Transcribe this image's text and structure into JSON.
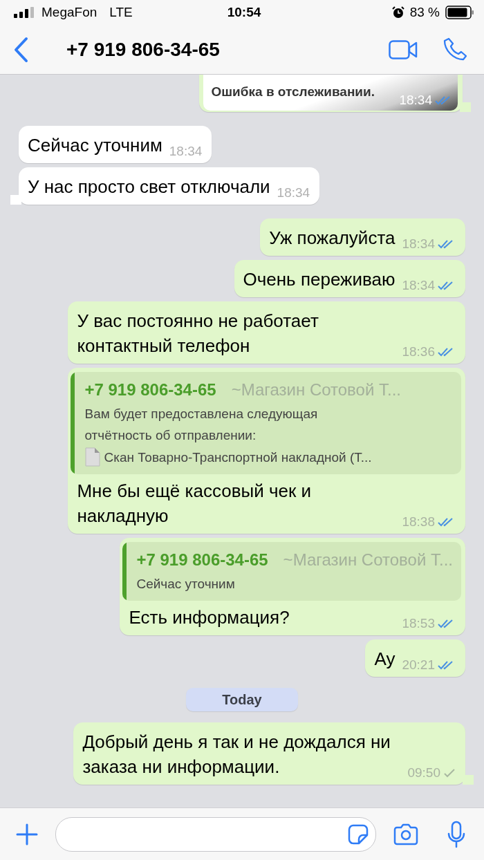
{
  "status_bar": {
    "carrier": "MegaFon",
    "network": "LTE",
    "time": "10:54",
    "battery": "83 %"
  },
  "header": {
    "title": "+7 919 806-34-65"
  },
  "messages": [
    {
      "kind": "image-preview",
      "outgoing": true,
      "text": "Ошибка в отслеживании.",
      "time": "18:34",
      "read": true,
      "tail": true
    },
    {
      "kind": "text",
      "outgoing": false,
      "text": "Сейчас уточним",
      "time": "18:34",
      "tail": false
    },
    {
      "kind": "text",
      "outgoing": false,
      "text": "У нас просто свет отключали",
      "time": "18:34",
      "tail": true
    },
    {
      "kind": "text",
      "outgoing": true,
      "text": "Уж пожалуйста",
      "time": "18:34",
      "read": true,
      "tail": false
    },
    {
      "kind": "text",
      "outgoing": true,
      "text": "Очень переживаю",
      "time": "18:34",
      "read": true,
      "tail": false
    },
    {
      "kind": "text",
      "outgoing": true,
      "text": "У вас постоянно не работает контактный телефон",
      "time": "18:36",
      "read": true,
      "tail": false
    },
    {
      "kind": "reply",
      "outgoing": true,
      "quote": {
        "sender": "+7 919 806-34-65",
        "group": "~Магазин Сотовой Т...",
        "lines": [
          "Вам будет предоставлена следующая",
          "отчётность об отправлении:"
        ],
        "file": "Скан Товарно-Транспортной накладной (Т..."
      },
      "text": "Мне бы ещё кассовый чек и накладную",
      "time": "18:38",
      "read": true,
      "tail": false
    },
    {
      "kind": "reply",
      "outgoing": true,
      "quote": {
        "sender": "+7 919 806-34-65",
        "group": "~Магазин Сотовой Т...",
        "lines": [
          "Сейчас уточним"
        ]
      },
      "text": "Есть информация?",
      "time": "18:53",
      "read": true,
      "tail": false
    },
    {
      "kind": "text",
      "outgoing": true,
      "text": "Ау",
      "time": "20:21",
      "read": true,
      "tail": false
    },
    {
      "kind": "date",
      "label": "Today"
    },
    {
      "kind": "text",
      "outgoing": true,
      "text": "Добрый день я так и не дождался ни заказа ни информации.",
      "time": "09:50",
      "read": false,
      "tail": true
    }
  ]
}
